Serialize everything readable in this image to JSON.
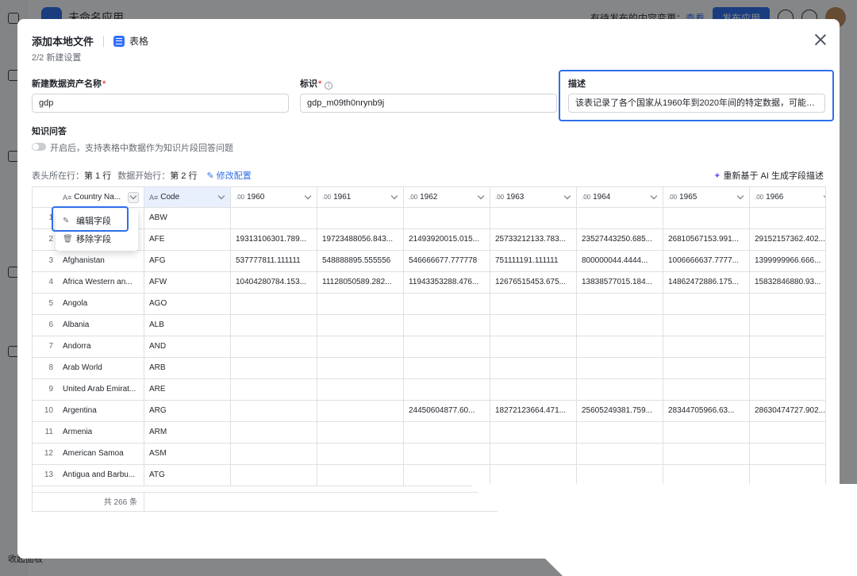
{
  "background": {
    "app_title": "未命名应用",
    "note": "有待发布的内容变更",
    "view_link": "查看",
    "publish_button": "发布应用",
    "footer": "收起面板"
  },
  "modal": {
    "title": "添加本地文件",
    "file_type": "表格",
    "step": "2/2 新建设置",
    "name_label": "新建数据资产名称",
    "name_value": "gdp",
    "id_label": "标识",
    "id_value": "gdp_m09th0nrynb9j",
    "desc_label": "描述",
    "desc_value": "该表记录了各个国家从1960年到2020年间的特定数据，可能用于...",
    "qa_label": "知识问答",
    "qa_toggle_text": "开启后，支持表格中数据作为知识片段回答问题",
    "header_row_label": "表头所在行：",
    "header_row_value": "第 1 行",
    "data_start_label": "数据开始行：",
    "data_start_value": "第 2 行",
    "edit_config": "修改配置",
    "ai_button": "重新基于 AI 生成字段描述"
  },
  "context_menu": {
    "edit": "编辑字段",
    "remove": "移除字段"
  },
  "table": {
    "columns": [
      {
        "type": "A≡",
        "label": "Country Na..."
      },
      {
        "type": "A≡",
        "label": "Code"
      },
      {
        "type": ".00",
        "label": "1960"
      },
      {
        "type": ".00",
        "label": "1961"
      },
      {
        "type": ".00",
        "label": "1962"
      },
      {
        "type": ".00",
        "label": "1963"
      },
      {
        "type": ".00",
        "label": "1964"
      },
      {
        "type": ".00",
        "label": "1965"
      },
      {
        "type": ".00",
        "label": "1966"
      }
    ],
    "rows": [
      {
        "idx": "1",
        "cells": [
          "",
          "ABW",
          "",
          "",
          "",
          "",
          "",
          "",
          ""
        ]
      },
      {
        "idx": "2",
        "cells": [
          "",
          "AFE",
          "19313106301.789...",
          "19723488056.843...",
          "21493920015.015...",
          "25733212133.783...",
          "23527443250.685...",
          "26810567153.991...",
          "29152157362.402..."
        ]
      },
      {
        "idx": "3",
        "cells": [
          "Afghanistan",
          "AFG",
          "537777811.111111",
          "548888895.555556",
          "546666677.777778",
          "751111191.111111",
          "800000044.4444...",
          "1006666637.7777...",
          "1399999966.666..."
        ]
      },
      {
        "idx": "4",
        "cells": [
          "Africa Western an...",
          "AFW",
          "10404280784.153...",
          "11128050589.282...",
          "11943353288.476...",
          "12676515453.675...",
          "13838577015.184...",
          "14862472886.175...",
          "15832846880.93..."
        ]
      },
      {
        "idx": "5",
        "cells": [
          "Angola",
          "AGO",
          "",
          "",
          "",
          "",
          "",
          "",
          ""
        ]
      },
      {
        "idx": "6",
        "cells": [
          "Albania",
          "ALB",
          "",
          "",
          "",
          "",
          "",
          "",
          ""
        ]
      },
      {
        "idx": "7",
        "cells": [
          "Andorra",
          "AND",
          "",
          "",
          "",
          "",
          "",
          "",
          ""
        ]
      },
      {
        "idx": "8",
        "cells": [
          "Arab World",
          "ARB",
          "",
          "",
          "",
          "",
          "",
          "",
          ""
        ]
      },
      {
        "idx": "9",
        "cells": [
          "United Arab Emirat...",
          "ARE",
          "",
          "",
          "",
          "",
          "",
          "",
          ""
        ]
      },
      {
        "idx": "10",
        "cells": [
          "Argentina",
          "ARG",
          "",
          "",
          "24450604877.60...",
          "18272123664.471...",
          "25605249381.759...",
          "28344705966.63...",
          "28630474727.902..."
        ]
      },
      {
        "idx": "11",
        "cells": [
          "Armenia",
          "ARM",
          "",
          "",
          "",
          "",
          "",
          "",
          ""
        ]
      },
      {
        "idx": "12",
        "cells": [
          "American Samoa",
          "ASM",
          "",
          "",
          "",
          "",
          "",
          "",
          ""
        ]
      },
      {
        "idx": "13",
        "cells": [
          "Antigua and Barbu...",
          "ATG",
          "",
          "",
          "",
          "",
          "",
          "",
          ""
        ]
      }
    ],
    "total": "共 266 条"
  },
  "colors": {
    "accent": "#2f6fe8",
    "highlight_border": "#2f6fe8",
    "required": "#f54a45",
    "ai_spark": "#7b5cf5"
  }
}
